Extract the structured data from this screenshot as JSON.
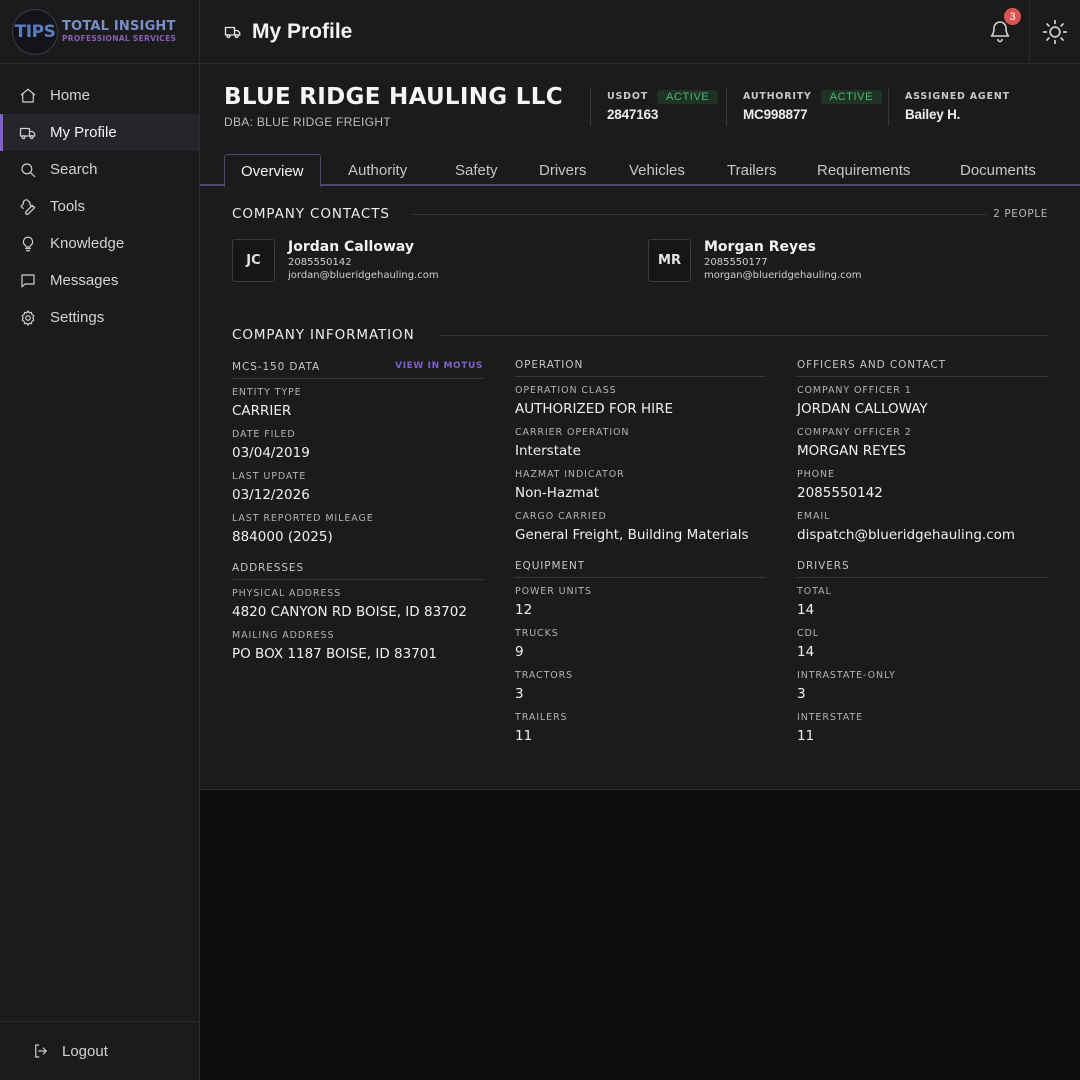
{
  "brand": {
    "logo_mark": "TIPS",
    "line1": "TOTAL INSIGHT",
    "line2": "PROFESSIONAL SERVICES"
  },
  "sidebar": {
    "items": [
      {
        "label": "Home",
        "icon": "home-icon"
      },
      {
        "label": "My Profile",
        "icon": "truck-icon",
        "active": true
      },
      {
        "label": "Search",
        "icon": "search-icon"
      },
      {
        "label": "Tools",
        "icon": "wrench-icon"
      },
      {
        "label": "Knowledge",
        "icon": "lightbulb-icon"
      },
      {
        "label": "Messages",
        "icon": "message-icon"
      },
      {
        "label": "Settings",
        "icon": "gear-icon"
      }
    ],
    "logout": "Logout"
  },
  "header": {
    "title": "My Profile",
    "notifications": "3"
  },
  "company": {
    "name": "BLUE RIDGE HAULING LLC",
    "dba": "DBA: BLUE RIDGE FREIGHT",
    "usdot": {
      "label": "USDOT",
      "status": "ACTIVE",
      "value": "2847163"
    },
    "authority": {
      "label": "AUTHORITY",
      "status": "ACTIVE",
      "value": "MC998877"
    },
    "agent": {
      "label": "ASSIGNED AGENT",
      "value": "Bailey H."
    }
  },
  "tabs": [
    "Overview",
    "Authority",
    "Safety",
    "Drivers",
    "Vehicles",
    "Trailers",
    "Requirements",
    "Documents"
  ],
  "contacts": {
    "title": "COMPANY CONTACTS",
    "count": "2 PEOPLE",
    "people": [
      {
        "initials": "JC",
        "name": "Jordan Calloway",
        "phone": "2085550142",
        "email": "jordan@blueridgehauling.com"
      },
      {
        "initials": "MR",
        "name": "Morgan Reyes",
        "phone": "2085550177",
        "email": "morgan@blueridgehauling.com"
      }
    ]
  },
  "info": {
    "title": "COMPANY INFORMATION",
    "mcs150": {
      "label": "MCS-150 DATA",
      "link": "VIEW IN MOTUS",
      "fields": [
        {
          "label": "ENTITY TYPE",
          "value": "CARRIER"
        },
        {
          "label": "DATE FILED",
          "value": "03/04/2019"
        },
        {
          "label": "LAST UPDATE",
          "value": "03/12/2026"
        },
        {
          "label": "LAST REPORTED MILEAGE",
          "value": "884000 (2025)"
        }
      ]
    },
    "addresses": {
      "label": "ADDRESSES",
      "fields": [
        {
          "label": "PHYSICAL ADDRESS",
          "value": "4820 CANYON RD BOISE, ID 83702"
        },
        {
          "label": "MAILING ADDRESS",
          "value": "PO BOX 1187 BOISE, ID 83701"
        }
      ]
    },
    "operation": {
      "label": "OPERATION",
      "fields": [
        {
          "label": "OPERATION CLASS",
          "value": "AUTHORIZED FOR HIRE"
        },
        {
          "label": "CARRIER OPERATION",
          "value": "Interstate"
        },
        {
          "label": "HAZMAT INDICATOR",
          "value": "Non-Hazmat"
        },
        {
          "label": "CARGO CARRIED",
          "value": "General Freight, Building Materials"
        }
      ]
    },
    "equipment": {
      "label": "EQUIPMENT",
      "fields": [
        {
          "label": "POWER UNITS",
          "value": "12"
        },
        {
          "label": "TRUCKS",
          "value": "9"
        },
        {
          "label": "TRACTORS",
          "value": "3"
        },
        {
          "label": "TRAILERS",
          "value": "11"
        }
      ]
    },
    "officers": {
      "label": "OFFICERS AND CONTACT",
      "fields": [
        {
          "label": "COMPANY OFFICER 1",
          "value": "JORDAN CALLOWAY"
        },
        {
          "label": "COMPANY OFFICER 2",
          "value": "MORGAN REYES"
        },
        {
          "label": "PHONE",
          "value": "2085550142"
        },
        {
          "label": "EMAIL",
          "value": "dispatch@blueridgehauling.com"
        }
      ]
    },
    "drivers": {
      "label": "DRIVERS",
      "fields": [
        {
          "label": "TOTAL",
          "value": "14"
        },
        {
          "label": "CDL",
          "value": "14"
        },
        {
          "label": "INTRASTATE-ONLY",
          "value": "3"
        },
        {
          "label": "INTERSTATE",
          "value": "11"
        }
      ]
    }
  },
  "colors": {
    "accent": "#7b63c9",
    "active_green": "#4fb56f",
    "badge_red": "#d9534f",
    "panel": "#1b1b1c",
    "background": "#0e0e0f"
  }
}
